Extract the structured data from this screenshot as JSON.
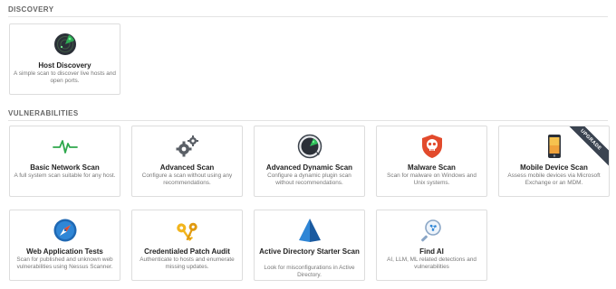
{
  "discovery": {
    "heading": "DISCOVERY",
    "cards": [
      {
        "title": "Host Discovery",
        "description": "A simple scan to discover live hosts and open ports.",
        "icon": "radar-icon"
      }
    ]
  },
  "vulnerabilities": {
    "heading": "VULNERABILITIES",
    "cards": [
      {
        "title": "Basic Network Scan",
        "description": "A full system scan suitable for any host.",
        "icon": "pulse-icon"
      },
      {
        "title": "Advanced Scan",
        "description": "Configure a scan without using any recommendations.",
        "icon": "gears-icon"
      },
      {
        "title": "Advanced Dynamic Scan",
        "description": "Configure a dynamic plugin scan without recommendations.",
        "icon": "dynamic-radar-icon"
      },
      {
        "title": "Malware Scan",
        "description": "Scan for malware on Windows and Unix systems.",
        "icon": "skull-shield-icon"
      },
      {
        "title": "Mobile Device Scan",
        "description": "Assess mobile devices via Microsoft Exchange or an MDM.",
        "icon": "mobile-phone-icon",
        "badge": "UPGRADE"
      },
      {
        "title": "Web Application Tests",
        "description": "Scan for published and unknown web vulnerabilities using Nessus Scanner.",
        "icon": "compass-icon"
      },
      {
        "title": "Credentialed Patch Audit",
        "description": "Authenticate to hosts and enumerate missing updates.",
        "icon": "keys-icon"
      },
      {
        "title": "Active Directory Starter Scan",
        "description": "Look for misconfigurations in Active Directory.",
        "icon": "pyramid-icon"
      },
      {
        "title": "Find AI",
        "description": "AI, LLM, ML related detections and vulnerabilities",
        "icon": "ai-magnifier-icon"
      }
    ]
  },
  "colors": {
    "accent_green": "#1d8a3c",
    "malware_red": "#e24a2c",
    "compass_blue": "#1f68b3",
    "keys_yellow": "#f2b51d",
    "ribbon_dark": "#3a4350"
  }
}
